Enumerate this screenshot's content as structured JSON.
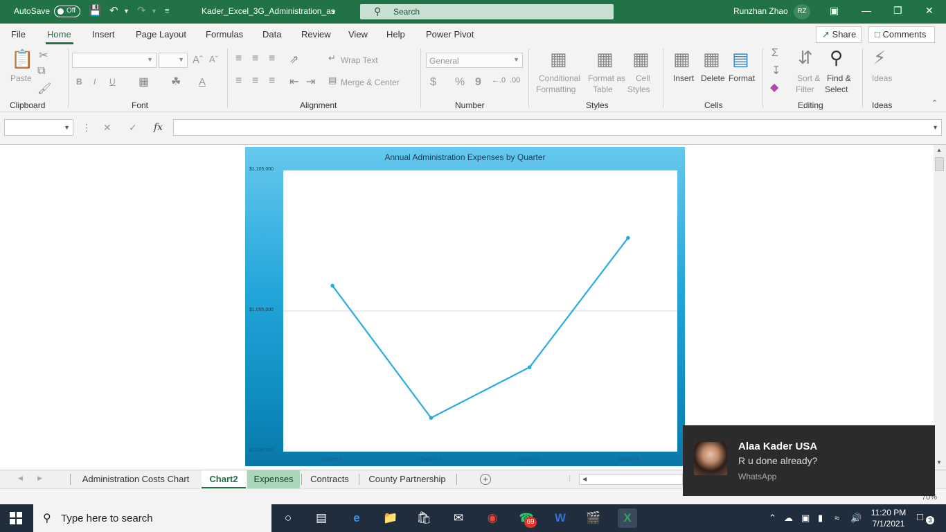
{
  "titlebar": {
    "autosave_label": "AutoSave",
    "autosave_state": "Off",
    "filename": "Kader_Excel_3G_Administration_as",
    "search_placeholder": "Search",
    "user_name": "Runzhan Zhao",
    "user_initials": "RZ"
  },
  "menu": {
    "items": [
      "File",
      "Home",
      "Insert",
      "Page Layout",
      "Formulas",
      "Data",
      "Review",
      "View",
      "Help",
      "Power Pivot"
    ],
    "active": "Home",
    "share_label": "Share",
    "comments_label": "Comments"
  },
  "ribbon": {
    "clipboard": {
      "group": "Clipboard",
      "paste": "Paste"
    },
    "font": {
      "group": "Font",
      "bold": "B",
      "italic": "I",
      "underline": "U"
    },
    "alignment": {
      "group": "Alignment",
      "wrap_text": "Wrap Text",
      "merge_center": "Merge & Center"
    },
    "number": {
      "group": "Number",
      "format_value": "General",
      "currency": "$",
      "percent": "%",
      "comma": "9"
    },
    "styles": {
      "group": "Styles",
      "conditional_1": "Conditional",
      "conditional_2": "Formatting",
      "format_table_1": "Format as",
      "format_table_2": "Table",
      "cell_styles_1": "Cell",
      "cell_styles_2": "Styles"
    },
    "cells": {
      "group": "Cells",
      "insert": "Insert",
      "delete": "Delete",
      "format": "Format"
    },
    "editing": {
      "group": "Editing",
      "sort_1": "Sort &",
      "sort_2": "Filter",
      "find_1": "Find &",
      "find_2": "Select"
    },
    "ideas": {
      "group": "Ideas",
      "label": "Ideas"
    }
  },
  "formula_bar": {
    "fx_label": "fx",
    "value": ""
  },
  "chart_data": {
    "type": "line",
    "title": "Annual Administration Expenses by Quarter",
    "y_ticks": [
      "$1,105,000",
      "$1,055,000",
      "$1,005,000"
    ],
    "ylim": [
      1005000,
      1105000
    ],
    "categories": [
      "Quarter 1",
      "Quarter 2",
      "Quarter 3",
      "Quarter 4"
    ],
    "values": [
      1064000,
      1017000,
      1035000,
      1081000
    ],
    "grid": true,
    "legend": "none",
    "line_color": "#29abe2",
    "background_gradient": [
      "#66c8ee",
      "#0a77a8"
    ]
  },
  "sheet_tabs": {
    "tabs": [
      "Administration Costs Chart",
      "Chart2",
      "Expenses",
      "Contracts",
      "County Partnership"
    ],
    "active": "Chart2",
    "highlighted": "Expenses"
  },
  "status": {
    "zoom": "70%"
  },
  "toast": {
    "sender": "Alaa Kader USA",
    "message": "R u done already?",
    "app": "WhatsApp"
  },
  "taskbar": {
    "search_placeholder": "Type here to search",
    "whatsapp_badge": "69",
    "time": "11:20 PM",
    "date": "7/1/2021",
    "notification_count": "3"
  }
}
